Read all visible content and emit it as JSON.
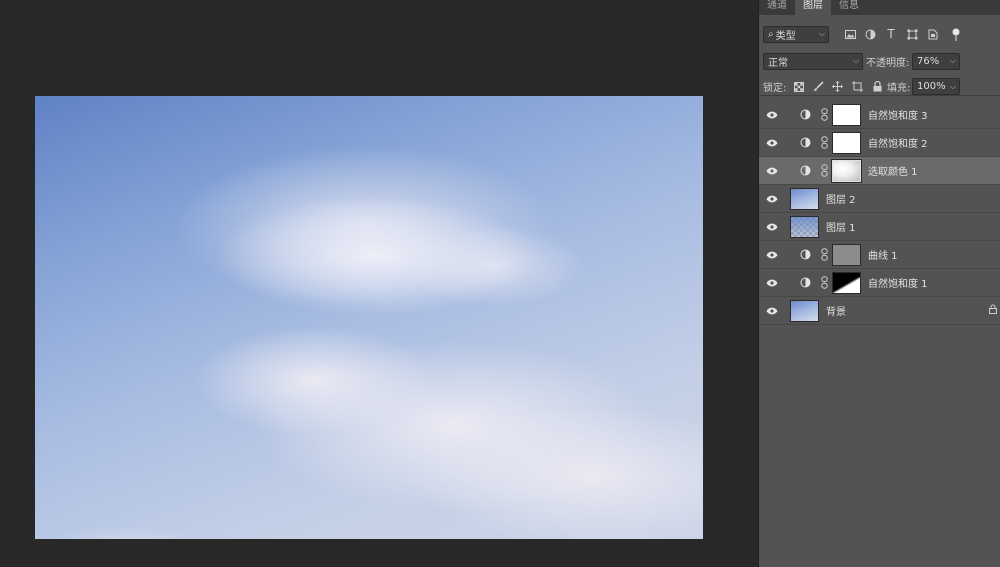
{
  "tabs": [
    "通道",
    "图层",
    "信息"
  ],
  "active_tab_index": 1,
  "filter": {
    "kind_label": "类型"
  },
  "blend": {
    "mode": "正常",
    "opacity_label": "不透明度:",
    "opacity_value": "76%"
  },
  "lock": {
    "label": "锁定:",
    "fill_label": "填充:",
    "fill_value": "100%"
  },
  "layers": [
    {
      "name": "自然饱和度 3",
      "type": "adjustment",
      "mask": "white",
      "selected": false
    },
    {
      "name": "自然饱和度 2",
      "type": "adjustment",
      "mask": "white",
      "selected": false
    },
    {
      "name": "选取颜色 1",
      "type": "adjustment",
      "mask": "gradient-white",
      "selected": true
    },
    {
      "name": "图层 2",
      "type": "pixel",
      "thumb": "sky",
      "selected": false
    },
    {
      "name": "图层 1",
      "type": "pixel",
      "thumb": "checker",
      "selected": false
    },
    {
      "name": "曲线 1",
      "type": "adjustment",
      "mask": "gray",
      "selected": false
    },
    {
      "name": "自然饱和度 1",
      "type": "adjustment",
      "mask": "black-white",
      "selected": false
    },
    {
      "name": "背景",
      "type": "background",
      "thumb": "sky",
      "locked": true,
      "selected": false
    }
  ]
}
